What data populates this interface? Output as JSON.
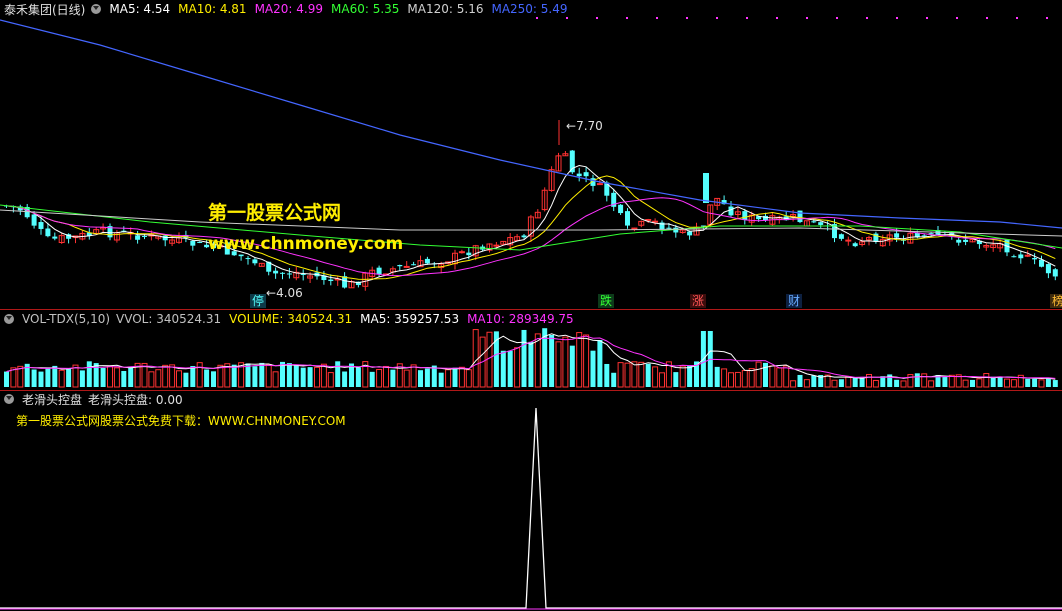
{
  "price_panel": {
    "stock_name": "泰禾集团(日线)",
    "ma_labels": [
      {
        "text": "MA5: 4.54",
        "color": "#ffffff"
      },
      {
        "text": "MA10: 4.81",
        "color": "#ffee00"
      },
      {
        "text": "MA20: 4.99",
        "color": "#ff33ff"
      },
      {
        "text": "MA60: 5.35",
        "color": "#33ff33"
      },
      {
        "text": "MA120: 5.16",
        "color": "#d0d0d0"
      },
      {
        "text": "MA250: 5.49",
        "color": "#4466ff"
      }
    ],
    "high_marker": "7.70",
    "low_marker": "4.06",
    "event_tags": [
      {
        "text": "停",
        "color": "#55ffff"
      },
      {
        "text": "跌",
        "color": "#33ff33"
      },
      {
        "text": "涨",
        "color": "#ff4444"
      },
      {
        "text": "财",
        "color": "#55aaff"
      },
      {
        "text": "榜",
        "color": "#ffbb33"
      }
    ],
    "watermark_cn": "第一股票公式网",
    "watermark_url": "www.chnmoney.com",
    "up_color": "#ff3232",
    "down_color": "#54ffff"
  },
  "volume_panel": {
    "indicator_name": "VOL-TDX(5,10)",
    "labels": [
      {
        "text": "VVOL: 340524.31",
        "color": "#c0c0c0"
      },
      {
        "text": "VOLUME: 340524.31",
        "color": "#ffee00"
      },
      {
        "text": "MA5: 359257.53",
        "color": "#ffffff"
      },
      {
        "text": "MA10: 289349.75",
        "color": "#ff33ff"
      }
    ]
  },
  "indicator_panel": {
    "indicator_name": "老滑头控盘",
    "value_label": "老滑头控盘: 0.00",
    "promo_text": "第一股票公式网股票公式免费下载：WWW.CHNMONEY.COM"
  }
}
